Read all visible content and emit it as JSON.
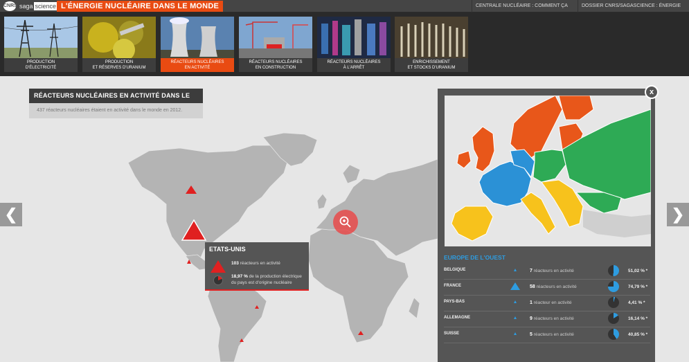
{
  "header": {
    "logo_cnrs": "CNRS",
    "logo_saga_a": "saga",
    "logo_saga_b": "science",
    "site_title": "L'ÉNERGIE NUCLÉAIRE DANS LE MONDE",
    "links": [
      "CENTRALE NUCLÉAIRE : COMMENT ÇA MARCHE ?",
      "DOSSIER CNRS/SAGASCIENCE : ÉNERGIE NUCLÉAIRE"
    ]
  },
  "nav": {
    "tiles": [
      {
        "line1": "Production",
        "line2": "d'électricité"
      },
      {
        "line1": "Production",
        "line2": "et réserves d'uranium"
      },
      {
        "line1": "Réacteurs nucléaires",
        "line2": "en activité"
      },
      {
        "line1": "Réacteurs nucléaires",
        "line2": "en construction"
      },
      {
        "line1": "Réacteurs nucléaires",
        "line2": "à l'arrêt"
      },
      {
        "line1": "Enrichissement",
        "line2": "et stocks d'uranium"
      }
    ],
    "active_index": 2
  },
  "panel": {
    "title": "Réacteurs nucléaires en activité dans le monde",
    "subtitle": "437 réacteurs nucléaires étaient en activité dans le monde en 2012."
  },
  "arrows": {
    "left": "❮",
    "right": "❯"
  },
  "tooltip": {
    "country": "ETATS-UNIS",
    "reactors_value": "103",
    "reactors_label": "réacteurs en activité",
    "share_value": "18,97 %",
    "share_label": "de la production électrique du pays est d'origine nucléaire"
  },
  "close_label": "x",
  "region": {
    "title": "Europe de l'Ouest",
    "rows": [
      {
        "country": "Belgique",
        "count": "7",
        "label": "réacteurs en activité",
        "pct": "51,02 % *",
        "share": 51.02,
        "big": false
      },
      {
        "country": "France",
        "count": "58",
        "label": "réacteurs en activité",
        "pct": "74,79 % *",
        "share": 74.79,
        "big": true
      },
      {
        "country": "Pays-Bas",
        "count": "1",
        "label": "réacteur en activité",
        "pct": "4,41 % *",
        "share": 4.41,
        "big": false
      },
      {
        "country": "Allemagne",
        "count": "9",
        "label": "réacteurs en activité",
        "pct": "16,14 % *",
        "share": 16.14,
        "big": false
      },
      {
        "country": "Suisse",
        "count": "5",
        "label": "réacteurs en activité",
        "pct": "40,85 % *",
        "share": 40.85,
        "big": false
      }
    ]
  },
  "colors": {
    "accent": "#e94b12",
    "reactor_red": "#e02020",
    "region_blue": "#2e9ce0",
    "europe_north": "#e8571a",
    "europe_west": "#2b91d6",
    "europe_south": "#f7c21c",
    "europe_east": "#2eaa55"
  }
}
